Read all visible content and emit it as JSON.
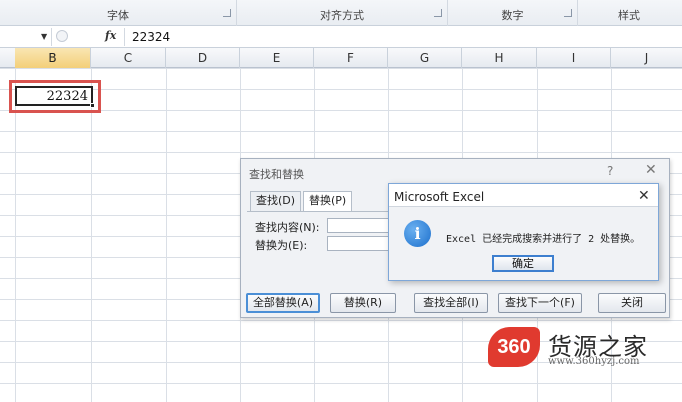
{
  "ribbon": {
    "groups": [
      {
        "label": "字体"
      },
      {
        "label": "对齐方式"
      },
      {
        "label": "数字"
      },
      {
        "label": "样式"
      }
    ]
  },
  "formula_bar": {
    "fx_label": "fx",
    "value": "22324"
  },
  "columns": [
    "B",
    "C",
    "D",
    "E",
    "F",
    "G",
    "H",
    "I",
    "J"
  ],
  "selected_column": "B",
  "active_cell": {
    "value": "22324"
  },
  "find_replace": {
    "title": "查找和替换",
    "help": "?",
    "close": "✕",
    "tabs": [
      {
        "label": "查找(D)",
        "active": false
      },
      {
        "label": "替换(P)",
        "active": true
      }
    ],
    "find_label": "查找内容(N):",
    "replace_label": "替换为(E):",
    "buttons": {
      "replace_all": "全部替换(A)",
      "replace": "替换(R)",
      "find_all": "查找全部(I)",
      "find_next": "查找下一个(F)",
      "close": "关闭"
    }
  },
  "message_box": {
    "title": "Microsoft Excel",
    "close": "✕",
    "icon": "info-icon",
    "icon_glyph": "i",
    "text": "Excel 已经完成搜索并进行了 2 处替换。",
    "ok": "确定"
  },
  "watermark": {
    "badge": "360",
    "name": "货源之家",
    "url": "www.360hyzj.com"
  },
  "colors": {
    "highlight_red": "#d9534f",
    "selected_header": "#f3cf79",
    "dialog_border": "#7ea7d8",
    "watermark_red": "#e03a2f"
  }
}
